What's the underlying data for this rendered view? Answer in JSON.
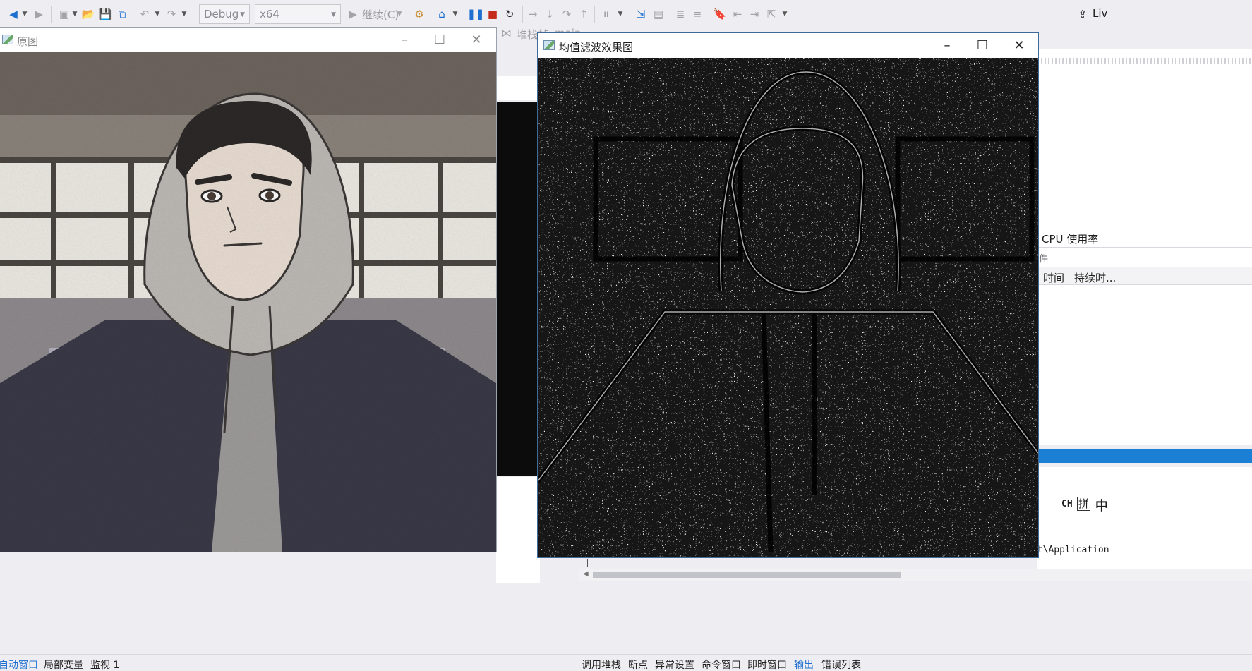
{
  "toolbar": {
    "config_combo": "Debug",
    "platform_combo": "x64",
    "continue_label": "继续(C)"
  },
  "background": {
    "stack_frame_label": "堆栈帧:",
    "stack_frame_value": "main",
    "cpu_usage_label": "CPU 使用率",
    "events_fragment": "件",
    "time_col": "时间",
    "duration_col": "持续时...",
    "ime_mode": "CH",
    "ime_pinyin": "拼",
    "ime_chinese": "中",
    "console_path_fragment": "ct\\Application",
    "live_share_fragment": "Liv"
  },
  "windows": {
    "original": {
      "title": "原图"
    },
    "filtered": {
      "title": "均值滤波效果图"
    }
  },
  "bottom_left_tabs": [
    "自动窗口",
    "局部变量",
    "监视 1"
  ],
  "bottom_right_tabs": [
    "调用堆栈",
    "断点",
    "异常设置",
    "命令窗口",
    "即时窗口",
    "输出",
    "错误列表"
  ],
  "colors": {
    "accent": "#1e6fd0",
    "toolbar_bg": "#eeeef2",
    "progress_blue": "#1c7fd6",
    "stop_red": "#c42b1c"
  }
}
